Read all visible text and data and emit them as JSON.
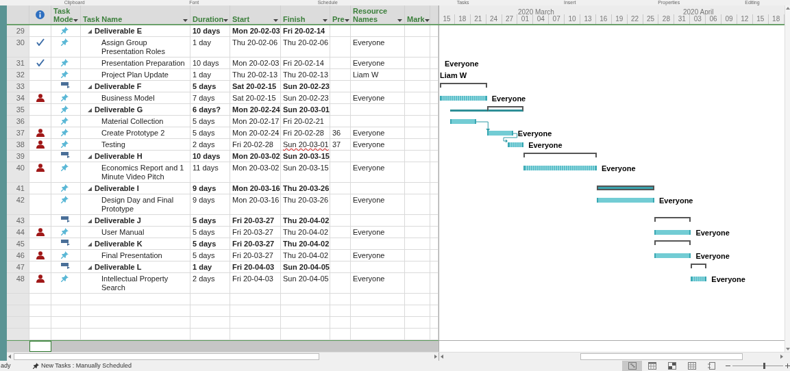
{
  "ribbon_groups": [
    "Clipboard",
    "Font",
    "Schedule",
    "Tasks",
    "Insert",
    "Properties",
    "Editing"
  ],
  "columns": {
    "task_mode": "Task Mode",
    "task_name": "Task Name",
    "duration": "Duration",
    "start": "Start",
    "finish": "Finish",
    "predecessors": "Pre",
    "resource_names": "Resource Names",
    "column_10": "Mark"
  },
  "timescale": {
    "months": [
      "2020 March",
      "2020 April"
    ],
    "days": [
      "15",
      "18",
      "21",
      "24",
      "27",
      "01",
      "04",
      "07",
      "10",
      "13",
      "16",
      "19",
      "22",
      "25",
      "28",
      "31",
      "03",
      "06",
      "09",
      "12",
      "15",
      "18"
    ]
  },
  "tasks": [
    {
      "id": "29",
      "completed": false,
      "overallocated": false,
      "manually_scheduled": true,
      "name": "Deliverable E",
      "duration": "10 days",
      "start": "Mon 20-02-03",
      "finish": "Fri 20-02-14",
      "finish_warning": false,
      "expanded": true,
      "children": [
        {
          "id": "30",
          "completed": true,
          "overallocated": false,
          "manually_scheduled": true,
          "name": "Assign Group Presentation Roles",
          "duration": "1 day",
          "start": "Thu 20-02-06",
          "finish": "Thu 20-02-06",
          "finish_warning": false,
          "resources": "Everyone"
        },
        {
          "id": "31",
          "completed": true,
          "overallocated": false,
          "manually_scheduled": true,
          "name": "Presentation Preparation",
          "duration": "10 days",
          "start": "Mon 20-02-03",
          "finish": "Fri 20-02-14",
          "finish_warning": false,
          "resources": "Everyone",
          "gantt_label": "Everyone"
        },
        {
          "id": "32",
          "completed": false,
          "overallocated": false,
          "manually_scheduled": true,
          "name": "Project Plan Update",
          "duration": "1 day",
          "start": "Thu 20-02-13",
          "finish": "Thu 20-02-13",
          "finish_warning": false,
          "resources": "Liam W",
          "gantt_label": "Liam W"
        }
      ]
    },
    {
      "id": "33",
      "completed": false,
      "overallocated": false,
      "manually_scheduled": false,
      "name": "Deliverable F",
      "duration": "5 days",
      "start": "Sat 20-02-15",
      "finish": "Sun 20-02-23",
      "finish_warning": false,
      "expanded": true,
      "kind": "bracket",
      "children": [
        {
          "id": "34",
          "completed": false,
          "overallocated": true,
          "manually_scheduled": true,
          "name": "Business Model",
          "duration": "7 days",
          "start": "Sat 20-02-15",
          "finish": "Sun 20-02-23",
          "finish_warning": false,
          "resources": "Everyone",
          "kind": "hatched",
          "gantt_label": "Everyone"
        }
      ]
    },
    {
      "id": "35",
      "completed": false,
      "overallocated": false,
      "manually_scheduled": true,
      "name": "Deliverable G",
      "duration": "6 days?",
      "start": "Mon 20-02-24",
      "finish": "Sun 20-03-01",
      "finish_warning": false,
      "expanded": true,
      "kind": "rollup",
      "children": [
        {
          "id": "36",
          "completed": false,
          "overallocated": false,
          "manually_scheduled": true,
          "name": "Material Collection",
          "duration": "5 days",
          "start": "Mon 20-02-17",
          "finish": "Fri 20-02-21",
          "finish_warning": false,
          "kind": "solid"
        },
        {
          "id": "37",
          "completed": false,
          "overallocated": true,
          "manually_scheduled": true,
          "name": "Create Prototype 2",
          "duration": "5 days",
          "start": "Mon 20-02-24",
          "finish": "Fri 20-02-28",
          "finish_warning": false,
          "predecessors": "36",
          "resources": "Everyone",
          "kind": "solid",
          "gantt_label": "Everyone"
        },
        {
          "id": "38",
          "completed": false,
          "overallocated": true,
          "manually_scheduled": true,
          "name": "Testing",
          "duration": "2 days",
          "start": "Fri 20-02-28",
          "finish": "Sun 20-03-01",
          "finish_warning": true,
          "predecessors": "37",
          "resources": "Everyone",
          "kind": "hatched",
          "gantt_label": "Everyone"
        }
      ]
    },
    {
      "id": "39",
      "completed": false,
      "overallocated": false,
      "manually_scheduled": false,
      "name": "Deliverable H",
      "duration": "10 days",
      "start": "Mon 20-03-02",
      "finish": "Sun 20-03-15",
      "finish_warning": false,
      "expanded": true,
      "kind": "bracket",
      "children": [
        {
          "id": "40",
          "completed": false,
          "overallocated": true,
          "manually_scheduled": true,
          "name": "Economics Report and 1 Minute Video Pitch",
          "duration": "11 days",
          "start": "Mon 20-03-02",
          "finish": "Sun 20-03-15",
          "finish_warning": false,
          "resources": "Everyone",
          "kind": "hatched",
          "gantt_label": "Everyone"
        }
      ]
    },
    {
      "id": "41",
      "completed": false,
      "overallocated": false,
      "manually_scheduled": true,
      "name": "Deliverable I",
      "duration": "9 days",
      "start": "Mon 20-03-16",
      "finish": "Thu 20-03-26",
      "finish_warning": false,
      "expanded": true,
      "kind": "filled",
      "children": [
        {
          "id": "42",
          "completed": false,
          "overallocated": false,
          "manually_scheduled": true,
          "name": "Design Day and Final Prototype",
          "duration": "9 days",
          "start": "Mon 20-03-16",
          "finish": "Thu 20-03-26",
          "finish_warning": false,
          "resources": "Everyone",
          "kind": "solid",
          "gantt_label": "Everyone"
        }
      ]
    },
    {
      "id": "43",
      "completed": false,
      "overallocated": false,
      "manually_scheduled": false,
      "name": "Deliverable J",
      "duration": "5 days",
      "start": "Fri 20-03-27",
      "finish": "Thu 20-04-02",
      "finish_warning": false,
      "expanded": true,
      "kind": "bracket",
      "children": [
        {
          "id": "44",
          "completed": false,
          "overallocated": true,
          "manually_scheduled": true,
          "name": "User Manual",
          "duration": "5 days",
          "start": "Fri 20-03-27",
          "finish": "Thu 20-04-02",
          "finish_warning": false,
          "resources": "Everyone",
          "kind": "solid",
          "gantt_label": "Everyone"
        }
      ]
    },
    {
      "id": "45",
      "completed": false,
      "overallocated": false,
      "manually_scheduled": false,
      "name": "Deliverable K",
      "duration": "5 days",
      "start": "Fri 20-03-27",
      "finish": "Thu 20-04-02",
      "finish_warning": false,
      "expanded": true,
      "kind": "bracket",
      "children": [
        {
          "id": "46",
          "completed": false,
          "overallocated": true,
          "manually_scheduled": true,
          "name": "Final Presentation",
          "duration": "5 days",
          "start": "Fri 20-03-27",
          "finish": "Thu 20-04-02",
          "finish_warning": false,
          "resources": "Everyone",
          "kind": "solid",
          "gantt_label": "Everyone"
        }
      ]
    },
    {
      "id": "47",
      "completed": false,
      "overallocated": false,
      "manually_scheduled": false,
      "name": "Deliverable L",
      "duration": "1 day",
      "start": "Fri 20-04-03",
      "finish": "Sun 20-04-05",
      "finish_warning": false,
      "expanded": true,
      "kind": "bracket",
      "children": [
        {
          "id": "48",
          "completed": false,
          "overallocated": true,
          "manually_scheduled": true,
          "name": "Intellectual Property Search",
          "duration": "2 days",
          "start": "Fri 20-04-03",
          "finish": "Sun 20-04-05",
          "finish_warning": false,
          "resources": "Everyone",
          "kind": "hatched",
          "gantt_label": "Everyone"
        }
      ]
    }
  ],
  "status_bar": {
    "ready": "ady",
    "new_tasks": "New Tasks : Manually Scheduled",
    "views": [
      {
        "kind": "gantt",
        "selected": true
      },
      {
        "kind": "calendar",
        "selected": false
      },
      {
        "kind": "usage",
        "selected": false
      },
      {
        "kind": "sheet",
        "selected": false
      },
      {
        "kind": "report",
        "selected": false
      }
    ],
    "zoom": {
      "level": 0.62
    }
  }
}
